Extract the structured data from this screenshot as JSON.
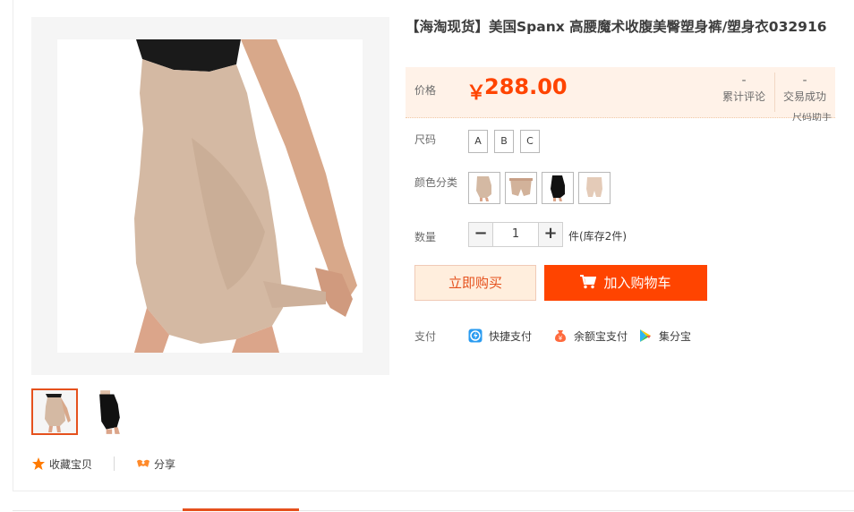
{
  "product": {
    "title": "【海淘现货】美国Spanx 高腰魔术收腹美臀塑身裤/塑身衣032916"
  },
  "price": {
    "label": "价格",
    "currency": "￥",
    "value": "288.00",
    "color": "#ff4400"
  },
  "stats": [
    {
      "value": "-",
      "label": "累计评论"
    },
    {
      "value": "-",
      "label": "交易成功"
    }
  ],
  "size_help": "尺码助手",
  "size": {
    "label": "尺码",
    "options": [
      "A",
      "B",
      "C"
    ]
  },
  "color": {
    "label": "颜色分类",
    "options": [
      "nude-front",
      "nude-detail",
      "black",
      "nude-plain"
    ]
  },
  "quantity": {
    "label": "数量",
    "decrement": "−",
    "value": "1",
    "increment": "+",
    "note": "件(库存2件)"
  },
  "actions": {
    "buy_now": "立即购买",
    "add_to_cart": "加入购物车"
  },
  "payment": {
    "label": "支付",
    "methods": [
      "快捷支付",
      "余额宝支付",
      "集分宝"
    ]
  },
  "social": {
    "favorite": "收藏宝贝",
    "share": "分享"
  },
  "theme": {
    "accent": "#e5511d",
    "price_bg": "#fff2e8",
    "garment_nude": "#d4b9a3",
    "garment_black": "#111111"
  }
}
